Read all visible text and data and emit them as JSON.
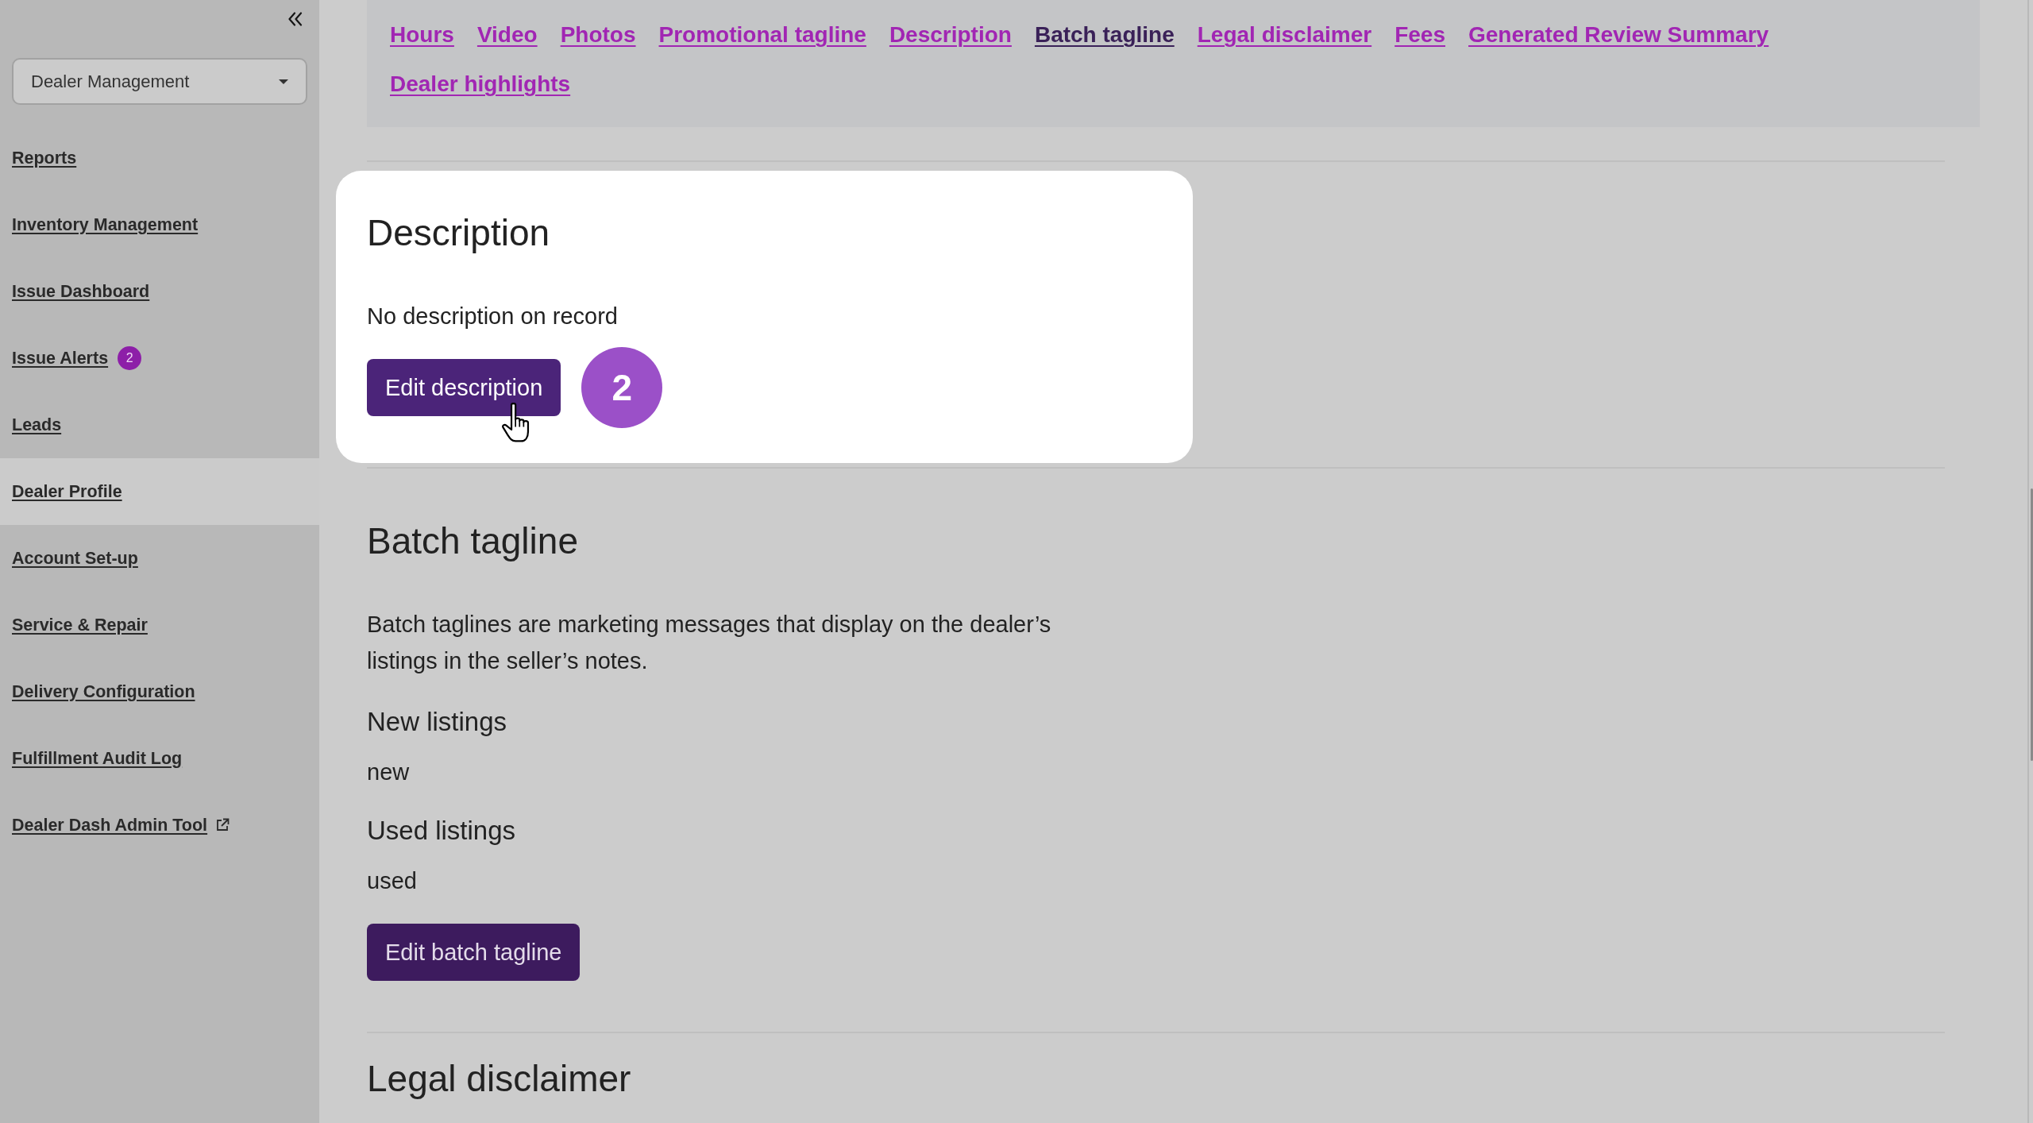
{
  "sidebar": {
    "dropdown": {
      "value": "Dealer Management"
    },
    "items": [
      {
        "label": "Reports",
        "selected": false,
        "external": false
      },
      {
        "label": "Inventory Management",
        "selected": false,
        "external": false
      },
      {
        "label": "Issue Dashboard",
        "selected": false,
        "external": false
      },
      {
        "label": "Issue Alerts",
        "selected": false,
        "external": false,
        "badge": "2"
      },
      {
        "label": "Leads",
        "selected": false,
        "external": false
      },
      {
        "label": "Dealer Profile",
        "selected": true,
        "external": false
      },
      {
        "label": "Account Set-up",
        "selected": false,
        "external": false
      },
      {
        "label": "Service & Repair",
        "selected": false,
        "external": false
      },
      {
        "label": "Delivery Configuration",
        "selected": false,
        "external": false
      },
      {
        "label": "Fulfillment Audit Log",
        "selected": false,
        "external": false
      },
      {
        "label": "Dealer Dash Admin Tool",
        "selected": false,
        "external": true
      }
    ]
  },
  "section_nav": [
    {
      "label": "Hours",
      "selected": false
    },
    {
      "label": "Video",
      "selected": false
    },
    {
      "label": "Photos",
      "selected": false
    },
    {
      "label": "Promotional tagline",
      "selected": false
    },
    {
      "label": "Description",
      "selected": false
    },
    {
      "label": "Batch tagline",
      "selected": true
    },
    {
      "label": "Legal disclaimer",
      "selected": false
    },
    {
      "label": "Fees",
      "selected": false
    },
    {
      "label": "Generated Review Summary",
      "selected": false
    },
    {
      "label": "Dealer highlights",
      "selected": false
    }
  ],
  "sections": [
    {
      "title": "Description",
      "highlighted": true,
      "text": "No description on record",
      "button": {
        "label": "Edit description",
        "hovered": true
      },
      "step_badge": "2"
    },
    {
      "title": "Batch tagline",
      "highlighted": false,
      "text": "Batch taglines are marketing messages that display on the dealer’s listings in the seller’s notes.",
      "fields": [
        {
          "label": "New listings",
          "value": "new"
        },
        {
          "label": "Used listings",
          "value": "used"
        }
      ],
      "button": {
        "label": "Edit batch tagline",
        "hovered": false
      }
    },
    {
      "title": "Legal disclaimer",
      "highlighted": false
    }
  ]
}
